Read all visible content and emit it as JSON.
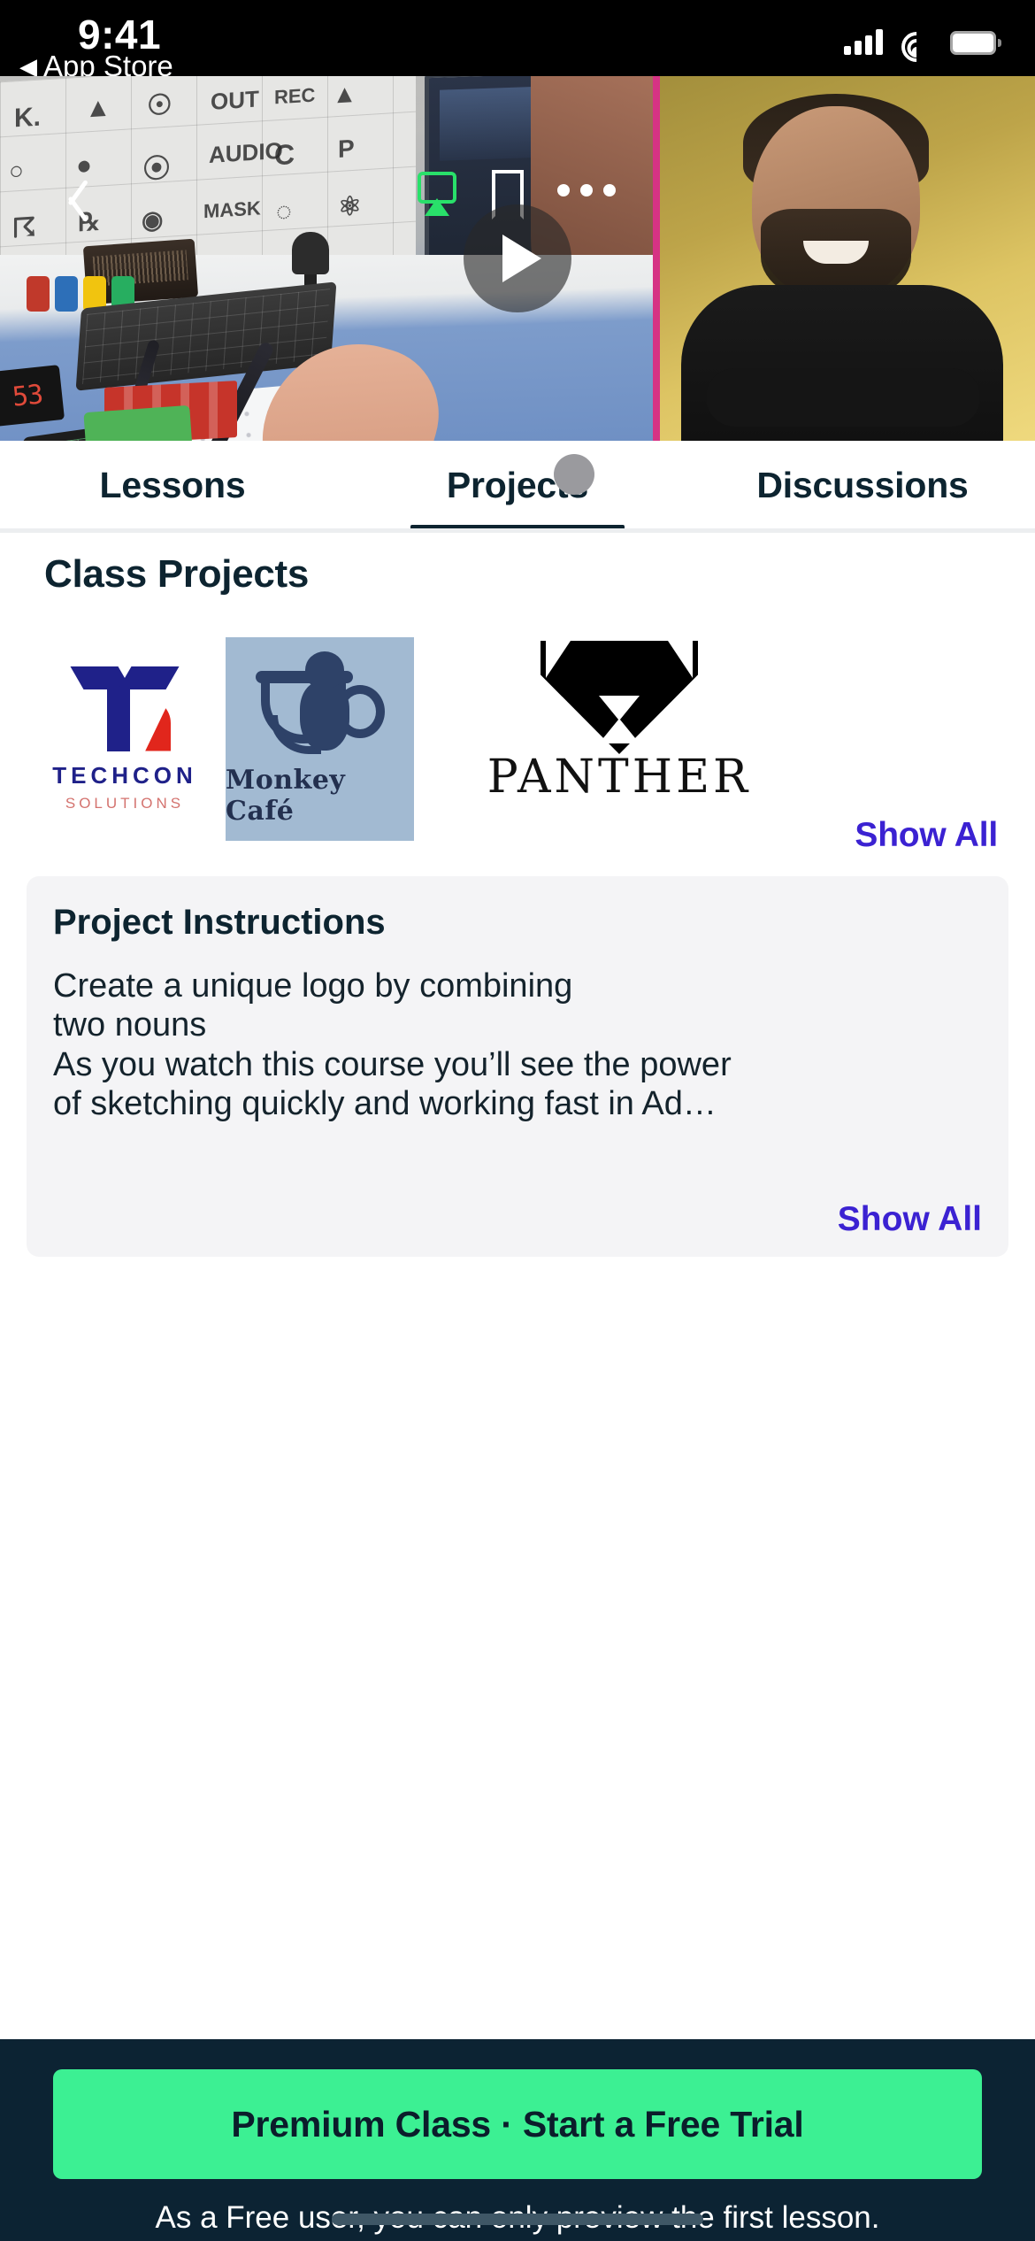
{
  "status_bar": {
    "time": "9:41",
    "back_label": "App Store",
    "back_caret": "◀",
    "cellular_icon": "signal-bars-icon",
    "wifi_icon": "wifi-icon",
    "battery_icon": "battery-full-icon"
  },
  "video": {
    "back_icon": "chevron-left-icon",
    "airplay_icon": "airplay-icon",
    "airplay_color": "#29e06a",
    "bookmark_icon": "bookmark-icon",
    "more_icon": "more-horizontal-icon",
    "play_icon": "play-triangle-icon",
    "clock_readout": "53"
  },
  "tabs": {
    "items": [
      {
        "label": "Lessons",
        "active": false
      },
      {
        "label": "Projects",
        "active": true
      },
      {
        "label": "Discussions",
        "active": false
      }
    ],
    "active_index": 1,
    "active_color": "#0d2430"
  },
  "projects_section": {
    "title": "Class Projects",
    "show_all_label": "Show All",
    "show_all_color": "#3b22d2",
    "items": [
      {
        "name": "TECHCON",
        "subtitle": "SOLUTIONS",
        "mark": "t-swoosh-mark",
        "colors": {
          "primary": "#1f2189",
          "accent": "#e1261c",
          "background": "#ffffff"
        }
      },
      {
        "name": "Monkey Café",
        "subtitle": "",
        "mark": "monkey-cup-mark",
        "colors": {
          "primary": "#2e4268",
          "accent": "#2e4268",
          "background": "#a2bad2"
        }
      },
      {
        "name": "PANTHER",
        "subtitle": "",
        "mark": "panther-head-mark",
        "colors": {
          "primary": "#000000",
          "accent": "#111111",
          "background": "#ffffff"
        }
      }
    ]
  },
  "instructions": {
    "title": "Project Instructions",
    "line1": "Create a unique logo by combining",
    "line2": "two nouns",
    "line3": "As you watch this course you’ll see the power",
    "line4": "of sketching quickly and working fast in Ad…",
    "show_all_label": "Show All",
    "show_all_color": "#3b22d2"
  },
  "footer": {
    "cta_label": "Premium Class · Start a Free Trial",
    "cta_color": "#3cf093",
    "note": "As a Free user, you can only preview the first lesson.",
    "background": "#0c2333",
    "home_indicator": "home-indicator"
  }
}
